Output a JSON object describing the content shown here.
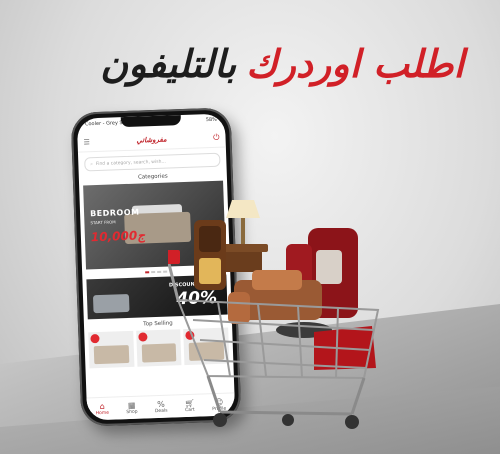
{
  "headline": {
    "part_red": "اطلب اوردرك",
    "part_dark": "بالتليفون"
  },
  "phone": {
    "status_left": "Cooler - Grey Sale - KC  6:16 PM",
    "status_right": "58%",
    "logo_text": "مفروشاتي",
    "search_placeholder": "Find a category, search, wish…",
    "categories_title": "Categories",
    "banner": {
      "title": "BEDROOM",
      "subtitle": "START FROM",
      "price": "10,000ج"
    },
    "discount": {
      "label": "DISCOUNTS UP TO",
      "value": "40%"
    },
    "top_selling_title": "Top Selling",
    "nav": [
      {
        "label": "Home",
        "icon": "home-icon"
      },
      {
        "label": "Shop",
        "icon": "shop-icon"
      },
      {
        "label": "Deals",
        "icon": "deals-icon"
      },
      {
        "label": "Cart",
        "icon": "cart-icon"
      },
      {
        "label": "Profile",
        "icon": "profile-icon"
      }
    ]
  },
  "colors": {
    "brand_red": "#c1262d",
    "dark_text": "#1d1d1d"
  }
}
